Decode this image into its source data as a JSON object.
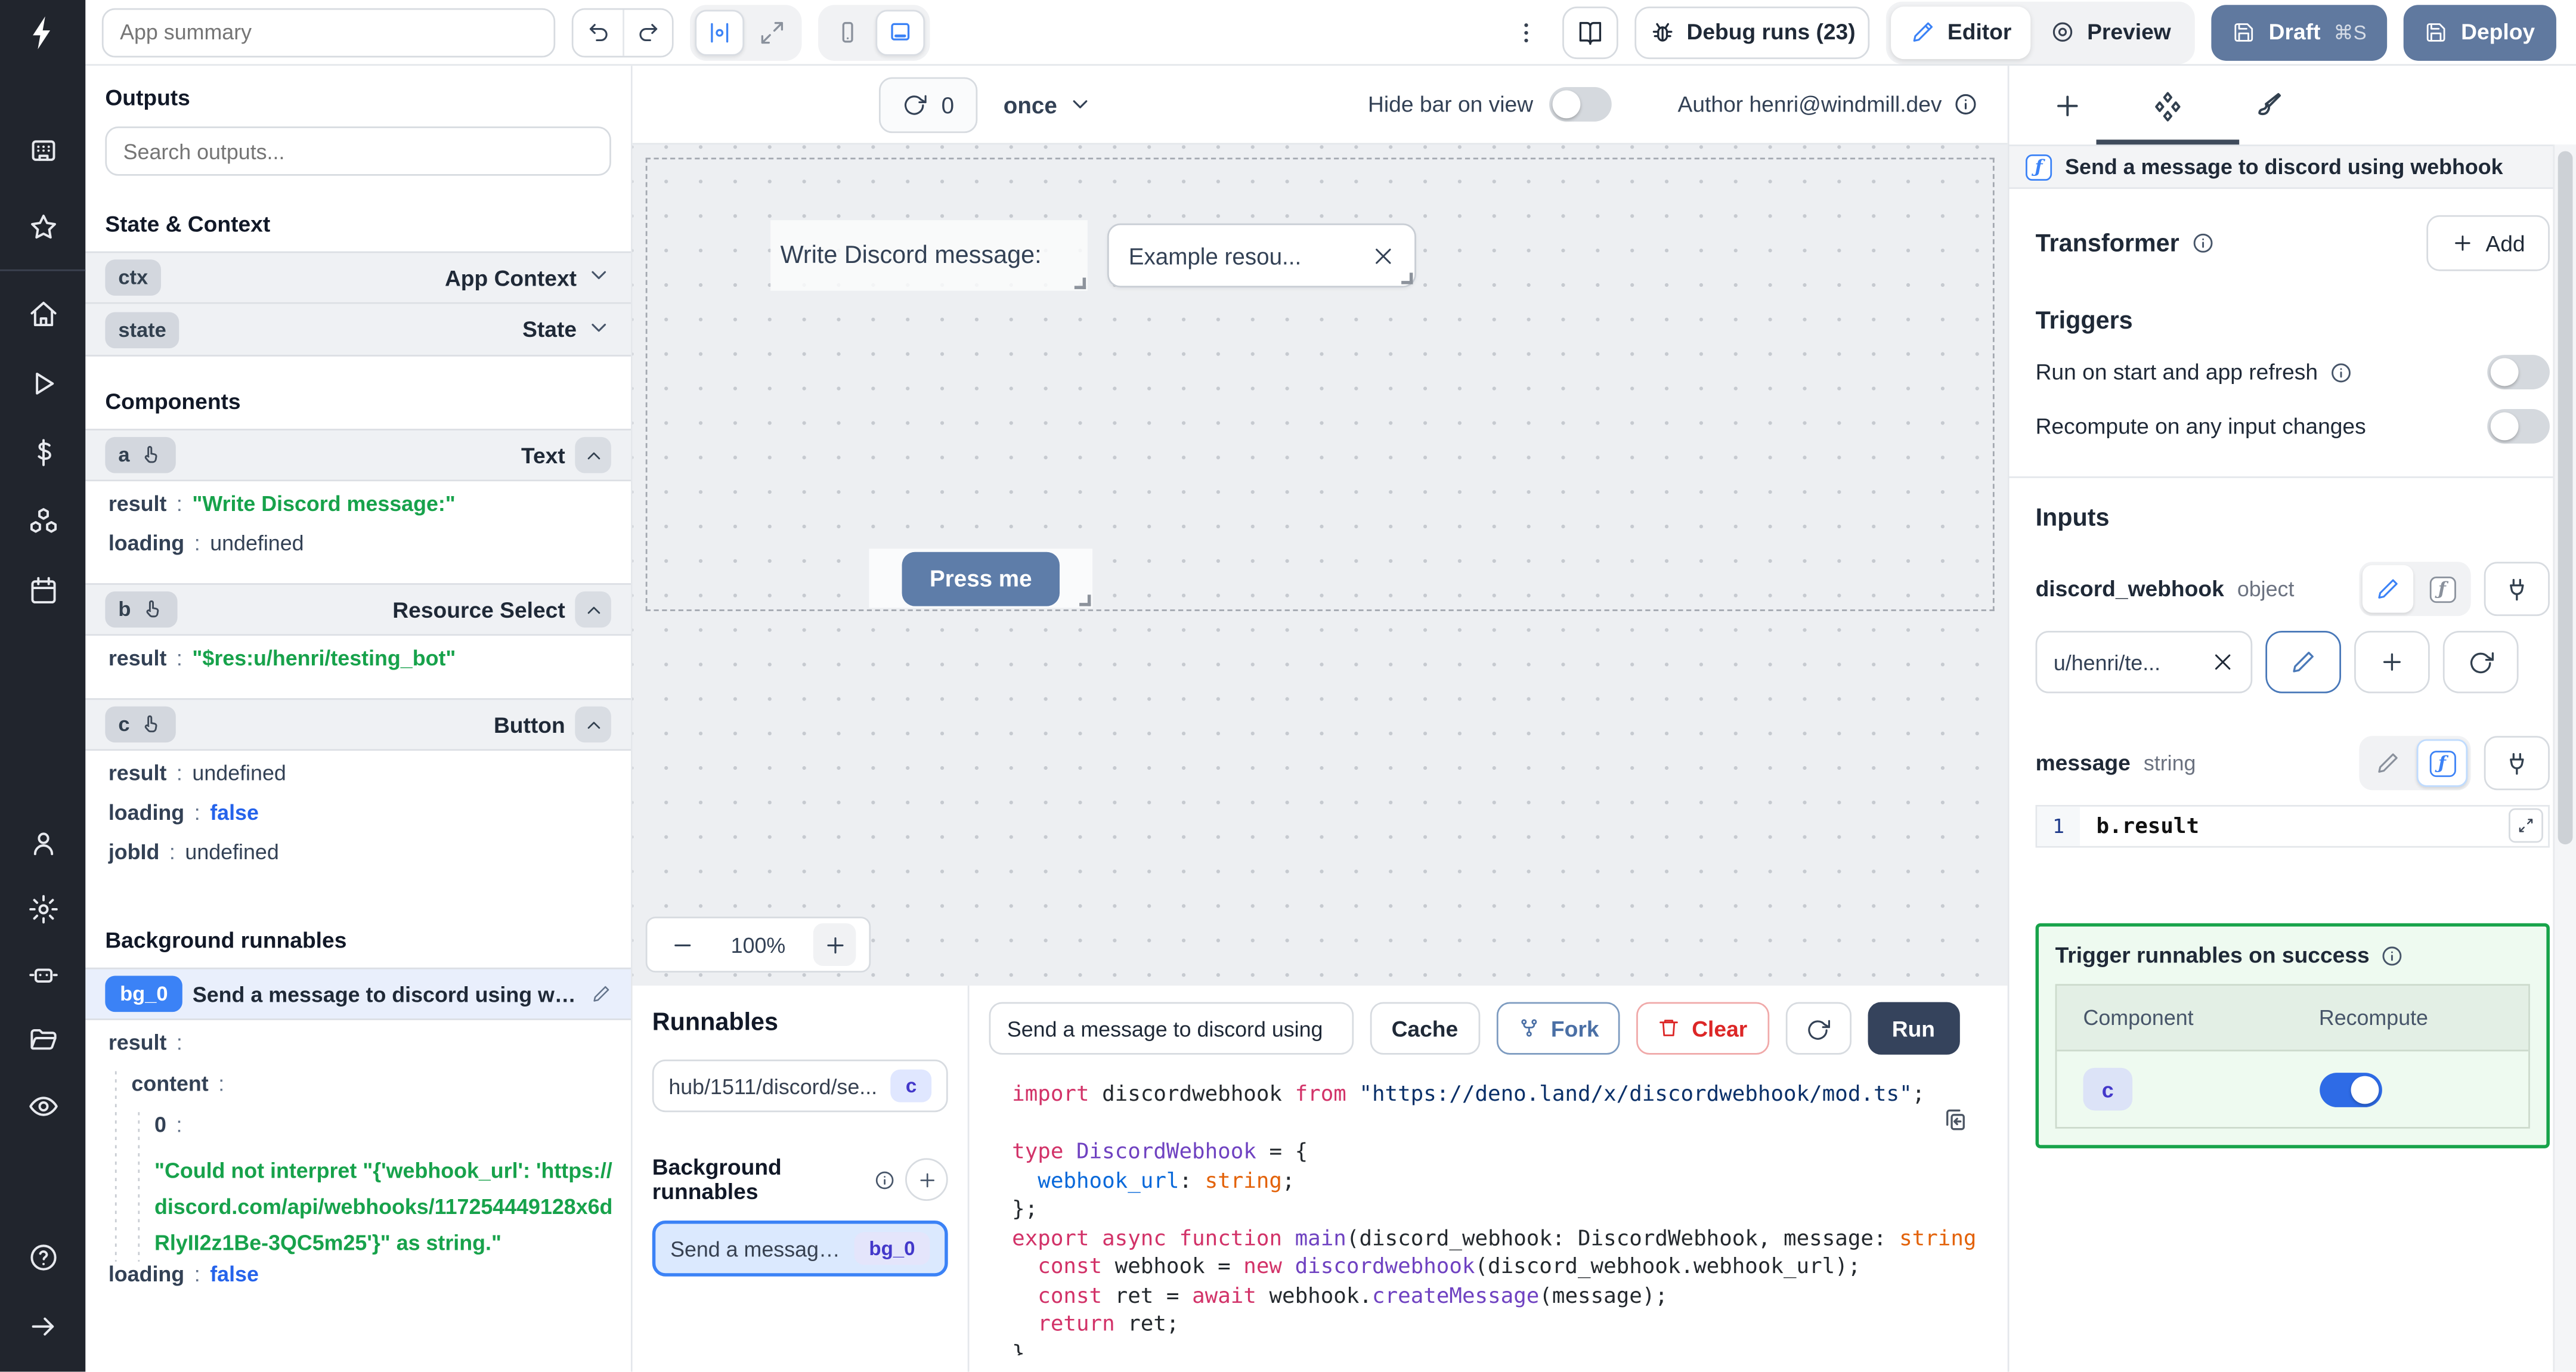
{
  "colors": {
    "accent": "#3b82f6",
    "slate_button": "#60799f",
    "press_me_button": "#5e7da9",
    "run_button": "#35435c",
    "success_green": "#17a34a",
    "string_green": "#17a24b",
    "bool_blue": "#2563eb",
    "badge_indigo": "#4338ca",
    "rail_bg": "#21252d"
  },
  "icons": {
    "windmill-logo-icon": "white lightning-bolt glyph",
    "undo-icon": "curved arrow left",
    "redo-icon": "curved arrow right",
    "align-center-icon": "two bars with circle",
    "expand-icon": "four corner arrows",
    "phone-icon": "smartphone outline",
    "desktop-icon": "monitor outline with bar",
    "kebab-icon": "vertical three dots",
    "book-icon": "open book",
    "bug-icon": "bug outline",
    "pencil-icon": "pencil",
    "preview-icon": "concentric circles",
    "save-icon": "floppy disk",
    "refresh-icon": "circular arrows",
    "chevron-down-icon": "v chevron",
    "chevron-up-icon": "^ chevron",
    "info-icon": "i in circle",
    "hand-pointer-icon": "pointing hand",
    "close-icon": "x cross",
    "plus-icon": "plus sign",
    "brush-icon": "paintbrush",
    "components-icon": "four diamonds",
    "function-icon": "italic f in rounded square",
    "plug-icon": "power plug",
    "trash-icon": "trash can",
    "fork-icon": "git fork",
    "copy-icon": "clipboard with arrow",
    "expand-diagonal-icon": "two diagonal arrows",
    "minus-icon": "minus sign",
    "workspace-icon": "machine with dots",
    "star-icon": "star outline",
    "home-icon": "house",
    "play-icon": "triangle",
    "dollar-icon": "dollar sign",
    "cubes-icon": "three cubes",
    "calendar-icon": "calendar",
    "user-icon": "person",
    "gear-icon": "cog",
    "robot-icon": "robot head",
    "folder-icon": "open folder",
    "eye-icon": "eye",
    "help-icon": "question mark in circle",
    "arrow-right-icon": "right arrow"
  },
  "rail": {
    "groups": [
      [
        "workspace-icon",
        "star-icon"
      ],
      [
        "home-icon",
        "play-icon",
        "dollar-icon",
        "cubes-icon",
        "calendar-icon"
      ],
      [
        "user-icon",
        "gear-icon",
        "robot-icon",
        "folder-icon",
        "eye-icon"
      ],
      [
        "help-icon",
        "arrow-right-icon"
      ]
    ]
  },
  "topbar": {
    "app_summary_placeholder": "App summary",
    "debug_runs_label": "Debug runs (23)",
    "editor_label": "Editor",
    "preview_label": "Preview",
    "draft_label": "Draft",
    "draft_shortcut": "⌘S",
    "deploy_label": "Deploy"
  },
  "canvas_bar": {
    "runs_count": "0",
    "schedule": "once",
    "hide_bar_label": "Hide bar on view",
    "hide_bar_on": false,
    "author_label": "Author henri@windmill.dev"
  },
  "outputs_panel": {
    "title": "Outputs",
    "search_placeholder": "Search outputs...",
    "state_context_title": "State & Context",
    "context_rows": [
      {
        "id": "ctx",
        "label": "App Context"
      },
      {
        "id": "state",
        "label": "State"
      }
    ],
    "components_title": "Components",
    "components": [
      {
        "id": "a",
        "type": "Text",
        "rows": [
          {
            "key": "result",
            "value": "\"Write Discord message:\"",
            "kind": "string"
          },
          {
            "key": "loading",
            "value": "undefined",
            "kind": "plain"
          }
        ]
      },
      {
        "id": "b",
        "type": "Resource Select",
        "rows": [
          {
            "key": "result",
            "value": "\"$res:u/henri/testing_bot\"",
            "kind": "string"
          }
        ]
      },
      {
        "id": "c",
        "type": "Button",
        "rows": [
          {
            "key": "result",
            "value": "undefined",
            "kind": "plain"
          },
          {
            "key": "loading",
            "value": "false",
            "kind": "bool"
          },
          {
            "key": "jobId",
            "value": "undefined",
            "kind": "plain"
          }
        ]
      }
    ],
    "background_title": "Background runnables",
    "background": {
      "id": "bg_0",
      "title": "Send a message to discord using webhook",
      "rows": [
        {
          "key": "result",
          "value": "",
          "kind": "none",
          "indent": 0
        },
        {
          "key": "content",
          "value": "",
          "kind": "none",
          "indent": 1
        },
        {
          "key": "0",
          "value": "",
          "kind": "none",
          "indent": 2
        },
        {
          "key": "",
          "value": "\"Could not interpret \"{'webhook_url': 'https://discord.com/api/webhooks/117254449128x6dRlyII2z1Be-3QC5m25'}\" as string.\"",
          "kind": "string",
          "indent": 2
        },
        {
          "key": "loading",
          "value": "false",
          "kind": "bool",
          "indent": 0
        }
      ]
    }
  },
  "canvas": {
    "text_component": "Write Discord message:",
    "select_value": "Example resou...",
    "button_label": "Press me",
    "zoom_value": "100%"
  },
  "runnables_panel": {
    "title": "Runnables",
    "item": {
      "name": "hub/1511/discord/se...",
      "badge": "c"
    },
    "background_title": "Background runnables",
    "selected": {
      "name": "Send a message...",
      "badge": "bg_0"
    }
  },
  "code_panel": {
    "name_value": "Send a message to discord using",
    "cache_label": "Cache",
    "fork_label": "Fork",
    "clear_label": "Clear",
    "run_label": "Run",
    "lines": [
      [
        {
          "t": "import",
          "c": "k"
        },
        {
          "t": " discordwebhook ",
          "c": "d"
        },
        {
          "t": "from",
          "c": "k"
        },
        {
          "t": " ",
          "c": "d"
        },
        {
          "t": "\"https://deno.land/x/discordwebhook/mod.ts\"",
          "c": "s"
        },
        {
          "t": ";",
          "c": "d"
        }
      ],
      [],
      [
        {
          "t": "type",
          "c": "k"
        },
        {
          "t": " ",
          "c": "d"
        },
        {
          "t": "DiscordWebhook",
          "c": "ty"
        },
        {
          "t": " = {",
          "c": "d"
        }
      ],
      [
        {
          "t": "  ",
          "c": "d"
        },
        {
          "t": "webhook_url",
          "c": "pr"
        },
        {
          "t": ": ",
          "c": "d"
        },
        {
          "t": "string",
          "c": "o"
        },
        {
          "t": ";",
          "c": "d"
        }
      ],
      [
        {
          "t": "};",
          "c": "d"
        }
      ],
      [
        {
          "t": "export",
          "c": "k"
        },
        {
          "t": " ",
          "c": "d"
        },
        {
          "t": "async",
          "c": "k"
        },
        {
          "t": " ",
          "c": "d"
        },
        {
          "t": "function",
          "c": "k"
        },
        {
          "t": " ",
          "c": "d"
        },
        {
          "t": "main",
          "c": "fn"
        },
        {
          "t": "(discord_webhook: DiscordWebhook, message: ",
          "c": "d"
        },
        {
          "t": "string",
          "c": "o"
        }
      ],
      [
        {
          "t": "  ",
          "c": "d"
        },
        {
          "t": "const",
          "c": "k"
        },
        {
          "t": " webhook = ",
          "c": "d"
        },
        {
          "t": "new",
          "c": "k"
        },
        {
          "t": " ",
          "c": "d"
        },
        {
          "t": "discordwebhook",
          "c": "fn"
        },
        {
          "t": "(discord_webhook.webhook_url);",
          "c": "d"
        }
      ],
      [
        {
          "t": "  ",
          "c": "d"
        },
        {
          "t": "const",
          "c": "k"
        },
        {
          "t": " ret = ",
          "c": "d"
        },
        {
          "t": "await",
          "c": "k"
        },
        {
          "t": " webhook.",
          "c": "d"
        },
        {
          "t": "createMessage",
          "c": "fn"
        },
        {
          "t": "(message);",
          "c": "d"
        }
      ],
      [
        {
          "t": "  ",
          "c": "d"
        },
        {
          "t": "return",
          "c": "k"
        },
        {
          "t": " ret;",
          "c": "d"
        }
      ],
      [
        {
          "t": "}",
          "c": "d"
        }
      ]
    ]
  },
  "right_panel": {
    "header_title": "Send a message to discord using webhook",
    "transformer": {
      "title": "Transformer",
      "add_label": "Add"
    },
    "triggers": {
      "title": "Triggers",
      "rows": [
        {
          "label": "Run on start and app refresh",
          "info": true,
          "on": false
        },
        {
          "label": "Recompute on any input changes",
          "info": false,
          "on": false
        }
      ]
    },
    "inputs": {
      "title": "Inputs",
      "discord_webhook": {
        "name": "discord_webhook",
        "type": "object",
        "value": "u/henri/te..."
      },
      "message": {
        "name": "message",
        "type": "string",
        "line_no": "1",
        "code": "b.result"
      }
    },
    "trigger_success": {
      "title": "Trigger runnables on success",
      "columns": [
        "Component",
        "Recompute"
      ],
      "rows": [
        {
          "component": "c",
          "recompute": true
        }
      ]
    }
  }
}
